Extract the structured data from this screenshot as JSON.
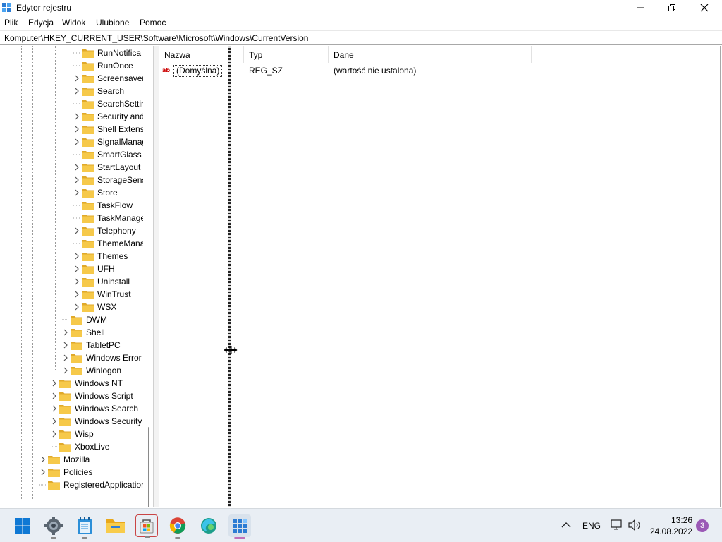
{
  "window": {
    "title": "Edytor rejestru"
  },
  "menu": [
    "Plik",
    "Edycja",
    "Widok",
    "Ulubione",
    "Pomoc"
  ],
  "address": "Komputer\\HKEY_CURRENT_USER\\Software\\Microsoft\\Windows\\CurrentVersion",
  "tree": [
    {
      "label": "RunNotifica",
      "level": 3,
      "expand": false
    },
    {
      "label": "RunOnce",
      "level": 3,
      "expand": false
    },
    {
      "label": "Screensavers",
      "level": 3,
      "expand": true
    },
    {
      "label": "Search",
      "level": 3,
      "expand": true
    },
    {
      "label": "SearchSettin",
      "level": 3,
      "expand": false
    },
    {
      "label": "Security and",
      "level": 3,
      "expand": true
    },
    {
      "label": "Shell Extensi",
      "level": 3,
      "expand": true
    },
    {
      "label": "SignalManag",
      "level": 3,
      "expand": true
    },
    {
      "label": "SmartGlass",
      "level": 3,
      "expand": false
    },
    {
      "label": "StartLayout",
      "level": 3,
      "expand": true
    },
    {
      "label": "StorageSens",
      "level": 3,
      "expand": true
    },
    {
      "label": "Store",
      "level": 3,
      "expand": true
    },
    {
      "label": "TaskFlow",
      "level": 3,
      "expand": false
    },
    {
      "label": "TaskManage",
      "level": 3,
      "expand": false
    },
    {
      "label": "Telephony",
      "level": 3,
      "expand": true
    },
    {
      "label": "ThemeMana",
      "level": 3,
      "expand": false
    },
    {
      "label": "Themes",
      "level": 3,
      "expand": true
    },
    {
      "label": "UFH",
      "level": 3,
      "expand": true
    },
    {
      "label": "Uninstall",
      "level": 3,
      "expand": true
    },
    {
      "label": "WinTrust",
      "level": 3,
      "expand": true
    },
    {
      "label": "WSX",
      "level": 3,
      "expand": true
    },
    {
      "label": "DWM",
      "level": 2,
      "expand": false
    },
    {
      "label": "Shell",
      "level": 2,
      "expand": true
    },
    {
      "label": "TabletPC",
      "level": 2,
      "expand": true
    },
    {
      "label": "Windows Error",
      "level": 2,
      "expand": true
    },
    {
      "label": "Winlogon",
      "level": 2,
      "expand": true
    },
    {
      "label": "Windows NT",
      "level": 1,
      "expand": true
    },
    {
      "label": "Windows Script",
      "level": 1,
      "expand": true
    },
    {
      "label": "Windows Search",
      "level": 1,
      "expand": true
    },
    {
      "label": "Windows Security",
      "level": 1,
      "expand": true
    },
    {
      "label": "Wisp",
      "level": 1,
      "expand": true
    },
    {
      "label": "XboxLive",
      "level": 1,
      "expand": false
    },
    {
      "label": "Mozilla",
      "level": 0,
      "expand": true
    },
    {
      "label": "Policies",
      "level": 0,
      "expand": true
    },
    {
      "label": "RegisteredApplication",
      "level": 0,
      "expand": false
    }
  ],
  "list": {
    "columns": [
      "Nazwa",
      "Typ",
      "Dane"
    ],
    "rows": [
      {
        "name": "(Domyślna)",
        "type": "REG_SZ",
        "data": "(wartość nie ustalona)"
      }
    ]
  },
  "taskbar": {
    "apps": [
      "start-icon",
      "settings-icon",
      "notepad-icon",
      "file-explorer-icon",
      "store-icon",
      "chrome-icon",
      "edge-icon",
      "regedit-icon"
    ],
    "tray": {
      "language": "ENG",
      "time": "13:26",
      "date": "24.08.2022",
      "notifications": "3"
    }
  },
  "colors": {
    "folder": "#f6c94a",
    "taskbar": "#e9eef4",
    "accent": "#0078d4"
  }
}
